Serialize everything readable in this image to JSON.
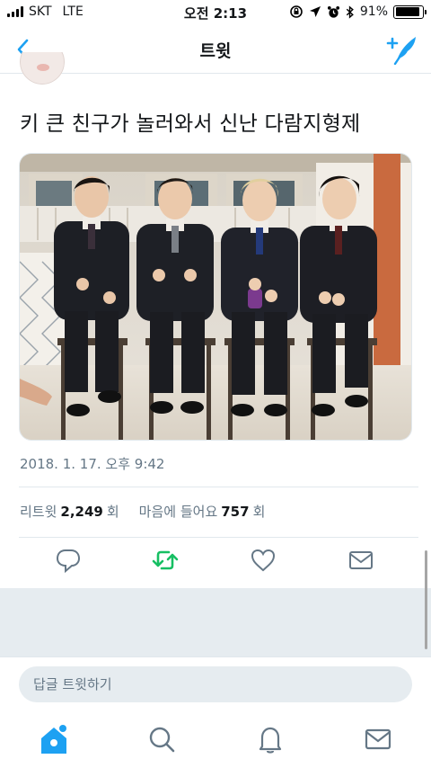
{
  "status_bar": {
    "carrier": "SKT",
    "network": "LTE",
    "time": "오전 2:13",
    "battery": "91%",
    "battery_level": 0.91
  },
  "navbar": {
    "title": "트윗",
    "icons": [
      "chevron-left-icon",
      "compose-tweet-icon"
    ]
  },
  "tweet": {
    "text": "키 큰 친구가 놀러와서 신난 다람지형제",
    "timestamp": "2018. 1. 17. 오후 9:42",
    "media_icon": "photo"
  },
  "stats": {
    "retweets_label": "리트윗",
    "retweets_count": "2,249",
    "retweets_unit": "회",
    "likes_label": "마음에 들어요",
    "likes_count": "757",
    "likes_unit": "회"
  },
  "actions": [
    "reply-icon",
    "retweet-icon",
    "like-icon",
    "share-icon"
  ],
  "reply": {
    "placeholder": "답글 트윗하기"
  },
  "tabbar": [
    "home-icon",
    "search-icon",
    "notifications-icon",
    "messages-icon"
  ],
  "colors": {
    "accent": "#1da1f2",
    "retweet": "#17bf63",
    "icon_gray": "#657786",
    "divider": "#e1e8ed",
    "background_gray": "#e6ecf0"
  }
}
